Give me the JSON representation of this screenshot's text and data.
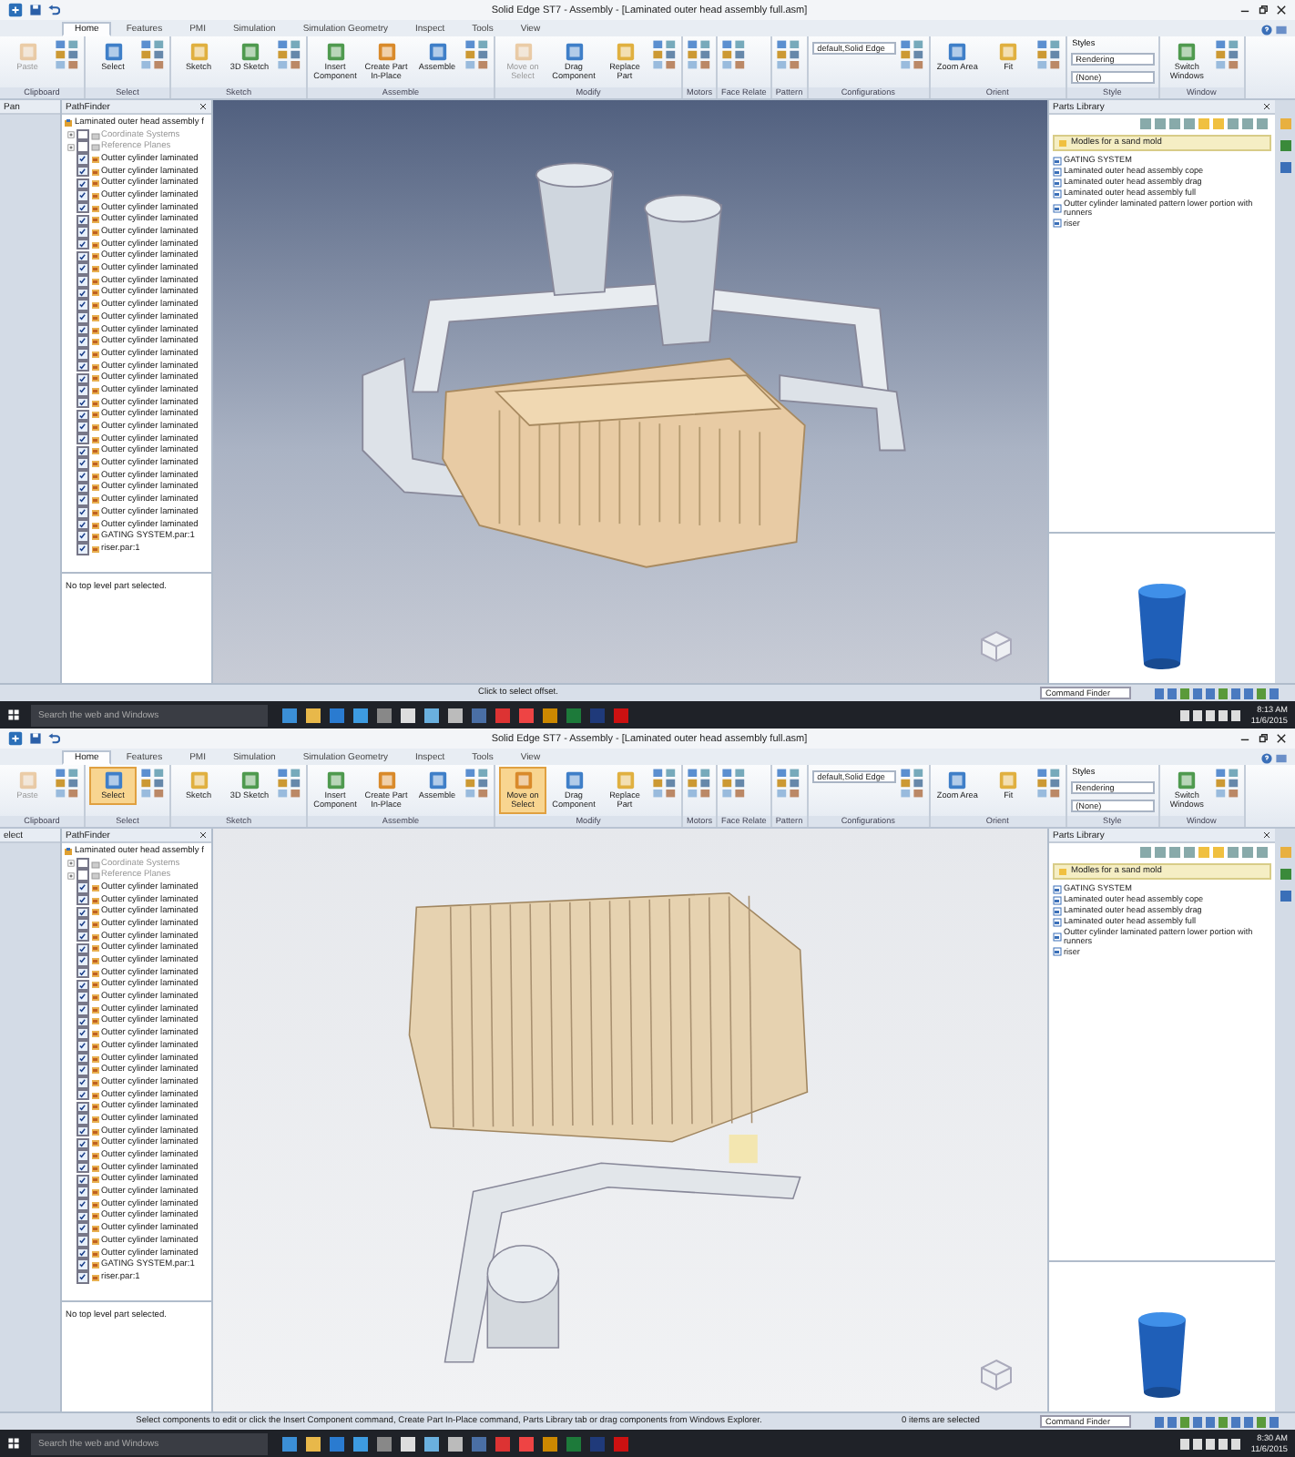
{
  "screens": [
    {
      "title": "Solid Edge ST7 - Assembly - [Laminated outer head assembly full.asm]",
      "tabs": [
        {
          "label": "Home",
          "selected": true
        },
        {
          "label": "Features",
          "selected": false
        },
        {
          "label": "PMI",
          "selected": false
        },
        {
          "label": "Simulation",
          "selected": false
        },
        {
          "label": "Simulation Geometry",
          "selected": false
        },
        {
          "label": "Inspect",
          "selected": false
        },
        {
          "label": "Tools",
          "selected": false
        },
        {
          "label": "View",
          "selected": false
        }
      ],
      "ribbon_groups": [
        {
          "label": "Clipboard",
          "items": [
            {
              "kind": "large",
              "label": "Paste",
              "selected": false,
              "disabled": true
            }
          ]
        },
        {
          "label": "Select",
          "items": [
            {
              "kind": "large",
              "label": "Select",
              "selected": false,
              "disabled": false
            }
          ]
        },
        {
          "label": "Sketch",
          "items": [
            {
              "kind": "large",
              "label": "Sketch",
              "selected": false,
              "disabled": false
            },
            {
              "kind": "large",
              "label": "3D Sketch",
              "selected": false,
              "disabled": false
            }
          ]
        },
        {
          "label": "Assemble",
          "items": [
            {
              "kind": "large",
              "label": "Insert Component",
              "selected": false,
              "disabled": false
            },
            {
              "kind": "large",
              "label": "Create Part In-Place",
              "selected": false,
              "disabled": false
            },
            {
              "kind": "large",
              "label": "Assemble",
              "selected": false,
              "disabled": false
            }
          ]
        },
        {
          "label": "Modify",
          "items": [
            {
              "kind": "large",
              "label": "Move on Select",
              "selected": false,
              "disabled": true
            },
            {
              "kind": "large",
              "label": "Drag Component",
              "selected": false,
              "disabled": false
            },
            {
              "kind": "large",
              "label": "Replace Part",
              "selected": false,
              "disabled": false
            }
          ]
        },
        {
          "label": "Motors"
        },
        {
          "label": "Face Relate"
        },
        {
          "label": "Pattern"
        },
        {
          "label": "Configurations",
          "items": [
            {
              "kind": "dropdown",
              "label": "default,Solid Edge"
            }
          ]
        },
        {
          "label": "Orient",
          "items": [
            {
              "kind": "large",
              "label": "Zoom Area",
              "selected": false,
              "disabled": false
            },
            {
              "kind": "large",
              "label": "Fit",
              "selected": false,
              "disabled": false
            }
          ]
        },
        {
          "label": "Style",
          "items": [
            {
              "kind": "small",
              "label": "Styles"
            },
            {
              "kind": "dropdown",
              "label": "Rendering"
            },
            {
              "kind": "dropdown",
              "label": "(None)"
            }
          ]
        },
        {
          "label": "Window",
          "items": [
            {
              "kind": "large",
              "label": "Switch Windows",
              "selected": false,
              "disabled": false
            }
          ]
        }
      ],
      "side_panel": {
        "title": "Pan"
      },
      "pathfinder": {
        "title": "PathFinder",
        "root": {
          "label": "Laminated outer head assembly f",
          "children": [
            {
              "kind": "folder",
              "label": "Coordinate Systems",
              "checked": false
            },
            {
              "kind": "folder",
              "label": "Reference Planes",
              "checked": false
            },
            {
              "kind": "part",
              "label": "Outter cylinder laminated",
              "checked": true
            },
            {
              "kind": "part",
              "label": "Outter cylinder laminated",
              "checked": true
            },
            {
              "kind": "part",
              "label": "Outter cylinder laminated",
              "checked": true
            },
            {
              "kind": "part",
              "label": "Outter cylinder laminated",
              "checked": true
            },
            {
              "kind": "part",
              "label": "Outter cylinder laminated",
              "checked": true
            },
            {
              "kind": "part",
              "label": "Outter cylinder laminated",
              "checked": true
            },
            {
              "kind": "part",
              "label": "Outter cylinder laminated",
              "checked": true
            },
            {
              "kind": "part",
              "label": "Outter cylinder laminated",
              "checked": true
            },
            {
              "kind": "part",
              "label": "Outter cylinder laminated",
              "checked": true
            },
            {
              "kind": "part",
              "label": "Outter cylinder laminated",
              "checked": true
            },
            {
              "kind": "part",
              "label": "Outter cylinder laminated",
              "checked": true
            },
            {
              "kind": "part",
              "label": "Outter cylinder laminated",
              "checked": true
            },
            {
              "kind": "part",
              "label": "Outter cylinder laminated",
              "checked": true
            },
            {
              "kind": "part",
              "label": "Outter cylinder laminated",
              "checked": true
            },
            {
              "kind": "part",
              "label": "Outter cylinder laminated",
              "checked": true
            },
            {
              "kind": "part",
              "label": "Outter cylinder laminated",
              "checked": true
            },
            {
              "kind": "part",
              "label": "Outter cylinder laminated",
              "checked": true
            },
            {
              "kind": "part",
              "label": "Outter cylinder laminated",
              "checked": true
            },
            {
              "kind": "part",
              "label": "Outter cylinder laminated",
              "checked": true
            },
            {
              "kind": "part",
              "label": "Outter cylinder laminated",
              "checked": true
            },
            {
              "kind": "part",
              "label": "Outter cylinder laminated",
              "checked": true
            },
            {
              "kind": "part",
              "label": "Outter cylinder laminated",
              "checked": true
            },
            {
              "kind": "part",
              "label": "Outter cylinder laminated",
              "checked": true
            },
            {
              "kind": "part",
              "label": "Outter cylinder laminated",
              "checked": true
            },
            {
              "kind": "part",
              "label": "Outter cylinder laminated",
              "checked": true
            },
            {
              "kind": "part",
              "label": "Outter cylinder laminated",
              "checked": true
            },
            {
              "kind": "part",
              "label": "Outter cylinder laminated",
              "checked": true
            },
            {
              "kind": "part",
              "label": "Outter cylinder laminated",
              "checked": true
            },
            {
              "kind": "part",
              "label": "Outter cylinder laminated",
              "checked": true
            },
            {
              "kind": "part",
              "label": "Outter cylinder laminated",
              "checked": true
            },
            {
              "kind": "part",
              "label": "Outter cylinder laminated",
              "checked": true
            },
            {
              "kind": "part",
              "label": "GATING SYSTEM.par:1",
              "checked": true
            },
            {
              "kind": "part",
              "label": "riser.par:1",
              "checked": true
            }
          ]
        },
        "message": "No top level part selected."
      },
      "parts_library": {
        "title": "Parts Library",
        "folder": "Modles for a sand mold",
        "items": [
          "GATING SYSTEM",
          "Laminated outer head assembly cope",
          "Laminated outer head assembly drag",
          "Laminated outer head assembly full",
          "Outter cylinder laminated pattern lower portion with runners",
          "riser"
        ]
      },
      "status": {
        "prompt": "Click to select offset.",
        "command_finder": {
          "placeholder": "Command Finder"
        }
      },
      "taskbar": {
        "search": {
          "placeholder": "Search the web and Windows"
        },
        "time": "8:13 AM",
        "date": "11/6/2015"
      }
    },
    {
      "title": "Solid Edge ST7 - Assembly - [Laminated outer head assembly full.asm]",
      "tabs": [
        {
          "label": "Home",
          "selected": true
        },
        {
          "label": "Features",
          "selected": false
        },
        {
          "label": "PMI",
          "selected": false
        },
        {
          "label": "Simulation",
          "selected": false
        },
        {
          "label": "Simulation Geometry",
          "selected": false
        },
        {
          "label": "Inspect",
          "selected": false
        },
        {
          "label": "Tools",
          "selected": false
        },
        {
          "label": "View",
          "selected": false
        }
      ],
      "ribbon_groups": [
        {
          "label": "Clipboard",
          "items": [
            {
              "kind": "large",
              "label": "Paste",
              "selected": false,
              "disabled": true
            }
          ]
        },
        {
          "label": "Select",
          "items": [
            {
              "kind": "large",
              "label": "Select",
              "selected": true,
              "disabled": false
            }
          ]
        },
        {
          "label": "Sketch",
          "items": [
            {
              "kind": "large",
              "label": "Sketch",
              "selected": false,
              "disabled": false
            },
            {
              "kind": "large",
              "label": "3D Sketch",
              "selected": false,
              "disabled": false
            }
          ]
        },
        {
          "label": "Assemble",
          "items": [
            {
              "kind": "large",
              "label": "Insert Component",
              "selected": false,
              "disabled": false
            },
            {
              "kind": "large",
              "label": "Create Part In-Place",
              "selected": false,
              "disabled": false
            },
            {
              "kind": "large",
              "label": "Assemble",
              "selected": false,
              "disabled": false
            }
          ]
        },
        {
          "label": "Modify",
          "items": [
            {
              "kind": "large",
              "label": "Move on Select",
              "selected": true,
              "disabled": false
            },
            {
              "kind": "large",
              "label": "Drag Component",
              "selected": false,
              "disabled": false
            },
            {
              "kind": "large",
              "label": "Replace Part",
              "selected": false,
              "disabled": false
            }
          ]
        },
        {
          "label": "Motors"
        },
        {
          "label": "Face Relate"
        },
        {
          "label": "Pattern"
        },
        {
          "label": "Configurations",
          "items": [
            {
              "kind": "dropdown",
              "label": "default,Solid Edge"
            }
          ]
        },
        {
          "label": "Orient",
          "items": [
            {
              "kind": "large",
              "label": "Zoom Area",
              "selected": false,
              "disabled": false
            },
            {
              "kind": "large",
              "label": "Fit",
              "selected": false,
              "disabled": false
            }
          ]
        },
        {
          "label": "Style",
          "items": [
            {
              "kind": "small",
              "label": "Styles"
            },
            {
              "kind": "dropdown",
              "label": "Rendering"
            },
            {
              "kind": "dropdown",
              "label": "(None)"
            }
          ]
        },
        {
          "label": "Window",
          "items": [
            {
              "kind": "large",
              "label": "Switch Windows",
              "selected": false,
              "disabled": false
            }
          ]
        }
      ],
      "side_panel": {
        "title": "elect"
      },
      "pathfinder": {
        "title": "PathFinder",
        "root": {
          "label": "Laminated outer head assembly f",
          "children": [
            {
              "kind": "folder",
              "label": "Coordinate Systems",
              "checked": false
            },
            {
              "kind": "folder",
              "label": "Reference Planes",
              "checked": false
            },
            {
              "kind": "part",
              "label": "Outter cylinder laminated",
              "checked": true
            },
            {
              "kind": "part",
              "label": "Outter cylinder laminated",
              "checked": true
            },
            {
              "kind": "part",
              "label": "Outter cylinder laminated",
              "checked": true
            },
            {
              "kind": "part",
              "label": "Outter cylinder laminated",
              "checked": true
            },
            {
              "kind": "part",
              "label": "Outter cylinder laminated",
              "checked": true
            },
            {
              "kind": "part",
              "label": "Outter cylinder laminated",
              "checked": true
            },
            {
              "kind": "part",
              "label": "Outter cylinder laminated",
              "checked": true
            },
            {
              "kind": "part",
              "label": "Outter cylinder laminated",
              "checked": true
            },
            {
              "kind": "part",
              "label": "Outter cylinder laminated",
              "checked": true
            },
            {
              "kind": "part",
              "label": "Outter cylinder laminated",
              "checked": true
            },
            {
              "kind": "part",
              "label": "Outter cylinder laminated",
              "checked": true
            },
            {
              "kind": "part",
              "label": "Outter cylinder laminated",
              "checked": true
            },
            {
              "kind": "part",
              "label": "Outter cylinder laminated",
              "checked": true
            },
            {
              "kind": "part",
              "label": "Outter cylinder laminated",
              "checked": true
            },
            {
              "kind": "part",
              "label": "Outter cylinder laminated",
              "checked": true
            },
            {
              "kind": "part",
              "label": "Outter cylinder laminated",
              "checked": true
            },
            {
              "kind": "part",
              "label": "Outter cylinder laminated",
              "checked": true
            },
            {
              "kind": "part",
              "label": "Outter cylinder laminated",
              "checked": true
            },
            {
              "kind": "part",
              "label": "Outter cylinder laminated",
              "checked": true
            },
            {
              "kind": "part",
              "label": "Outter cylinder laminated",
              "checked": true
            },
            {
              "kind": "part",
              "label": "Outter cylinder laminated",
              "checked": true
            },
            {
              "kind": "part",
              "label": "Outter cylinder laminated",
              "checked": true
            },
            {
              "kind": "part",
              "label": "Outter cylinder laminated",
              "checked": true
            },
            {
              "kind": "part",
              "label": "Outter cylinder laminated",
              "checked": true
            },
            {
              "kind": "part",
              "label": "Outter cylinder laminated",
              "checked": true
            },
            {
              "kind": "part",
              "label": "Outter cylinder laminated",
              "checked": true
            },
            {
              "kind": "part",
              "label": "Outter cylinder laminated",
              "checked": true
            },
            {
              "kind": "part",
              "label": "Outter cylinder laminated",
              "checked": true
            },
            {
              "kind": "part",
              "label": "Outter cylinder laminated",
              "checked": true
            },
            {
              "kind": "part",
              "label": "Outter cylinder laminated",
              "checked": true
            },
            {
              "kind": "part",
              "label": "Outter cylinder laminated",
              "checked": true
            },
            {
              "kind": "part",
              "label": "GATING SYSTEM.par:1",
              "checked": true
            },
            {
              "kind": "part",
              "label": "riser.par:1",
              "checked": true
            }
          ]
        },
        "message": "No top level part selected."
      },
      "parts_library": {
        "title": "Parts Library",
        "folder": "Modles for a sand mold",
        "items": [
          "GATING SYSTEM",
          "Laminated outer head assembly cope",
          "Laminated outer head assembly drag",
          "Laminated outer head assembly full",
          "Outter cylinder laminated pattern lower portion with runners",
          "riser"
        ]
      },
      "status": {
        "prompt": "Select components to edit or click the Insert Component command, Create Part In-Place command, Parts Library tab or drag components from Windows Explorer.",
        "selection": "0 items are selected",
        "command_finder": {
          "placeholder": "Command Finder"
        }
      },
      "taskbar": {
        "search": {
          "placeholder": "Search the web and Windows"
        },
        "time": "8:30 AM",
        "date": "11/6/2015"
      }
    }
  ]
}
